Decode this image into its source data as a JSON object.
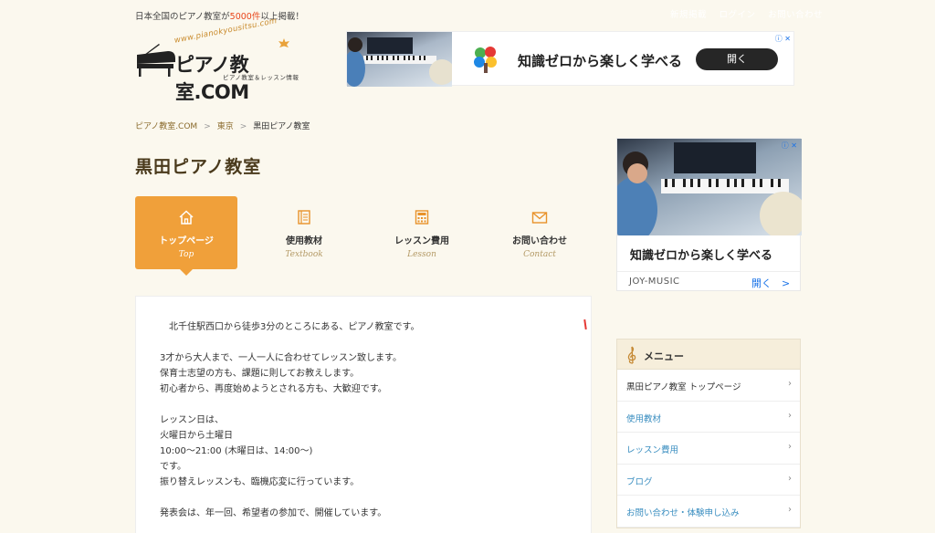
{
  "header": {
    "tagline_prefix": "日本全国のピアノ教室が",
    "tagline_count": "5000件",
    "tagline_suffix": "以上掲載！",
    "top_links": [
      "新規掲載",
      "ログイン",
      "お問い合わせ"
    ],
    "logo": {
      "url_text": "www.pianokyousitsu.com",
      "title": "ピアノ教室.COM",
      "subtitle": "ピアノ教室＆レッスン情報"
    }
  },
  "ad_top": {
    "headline": "知識ゼロから楽しく学べる",
    "button": "開く"
  },
  "breadcrumb": {
    "items": [
      "ピアノ教室.COM",
      "東京"
    ],
    "separator": ">",
    "current": "黒田ピアノ教室"
  },
  "page_title": "黒田ピアノ教室",
  "nav": {
    "tabs": [
      {
        "label": "トップページ",
        "en": "Top",
        "icon": "home-icon",
        "active": true
      },
      {
        "label": "使用教材",
        "en": "Textbook",
        "icon": "book-icon",
        "active": false
      },
      {
        "label": "レッスン費用",
        "en": "Lesson",
        "icon": "calculator-icon",
        "active": false
      },
      {
        "label": "お問い合わせ",
        "en": "Contact",
        "icon": "mail-icon",
        "active": false
      }
    ]
  },
  "content": {
    "paragraphs": [
      [
        "　北千住駅西口から徒歩3分のところにある、ピアノ教室です。"
      ],
      [
        "3才から大人まで、一人一人に合わせてレッスン致します。",
        "保育士志望の方も、課題に則してお教えします。",
        "初心者から、再度始めようとされる方も、大歓迎です。"
      ],
      [
        "レッスン日は、",
        "火曜日から土曜日",
        "10:00〜21:00 (木曜日は、14:00〜)",
        "です。",
        "振り替えレッスンも、臨機応変に行っています。"
      ],
      [
        "発表会は、年一回、希望者の参加で、開催しています。"
      ]
    ]
  },
  "ad_side": {
    "headline": "知識ゼロから楽しく学べる",
    "brand": "JOY-MUSIC",
    "open": "開く　>"
  },
  "menu": {
    "title": "メニュー",
    "items": [
      "黒田ピアノ教室 トップページ",
      "使用教材",
      "レッスン費用",
      "ブログ",
      "お問い合わせ・体験申し込み"
    ]
  },
  "colors": {
    "accent": "#f0a03a",
    "link": "#3a8ec0",
    "background": "#fbf8ee"
  }
}
